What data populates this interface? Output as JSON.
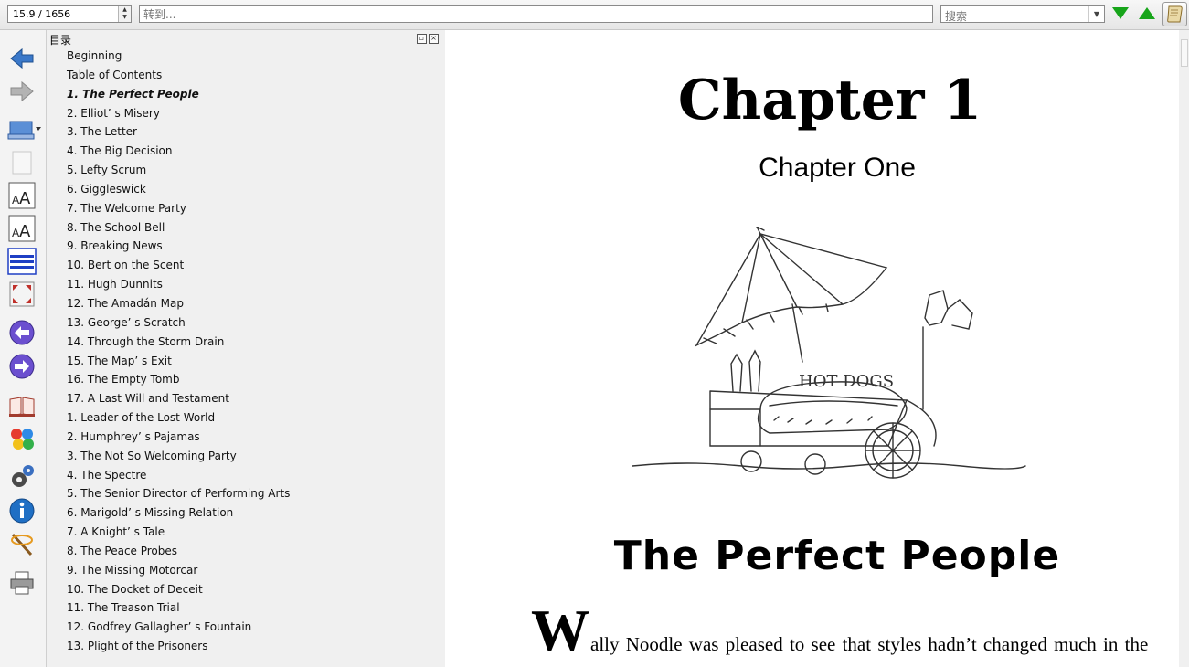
{
  "toolbar": {
    "page_indicator": "15.9 / 1656",
    "goto_placeholder": "转到...",
    "search_placeholder": "搜索",
    "colors": {
      "nav_green": "#17a51a"
    }
  },
  "sidebar_icons": [
    "back-arrow-icon",
    "forward-arrow-icon",
    "library-icon",
    "page-icon",
    "font-increase-icon",
    "font-decrease-icon",
    "toc-list-icon",
    "fullscreen-icon",
    "prev-chapter-icon",
    "next-chapter-icon",
    "book-icon",
    "colors-icon",
    "settings-icon",
    "info-icon",
    "tools-icon",
    "print-icon"
  ],
  "toc": {
    "title": "目录",
    "items": [
      "Beginning",
      "Table of Contents",
      "1. The Perfect People",
      "2. Elliot’ s Misery",
      "3. The Letter",
      "4. The Big Decision",
      "5. Lefty Scrum",
      "6. Giggleswick",
      "7. The Welcome Party",
      "8. The School Bell",
      "9. Breaking News",
      "10. Bert on the Scent",
      "11. Hugh Dunnits",
      "12. The Amadán Map",
      "13. George’ s Scratch",
      "14. Through the Storm Drain",
      "15. The Map’ s Exit",
      "16. The Empty Tomb",
      "17. A Last Will and Testament",
      "1. Leader of the Lost World",
      "2. Humphrey’ s Pajamas",
      "3. The Not So Welcoming Party",
      "4. The Spectre",
      "5. The Senior Director of Performing Arts",
      "6. Marigold’ s Missing Relation",
      "7. A Knight’ s Tale",
      "8. The Peace Probes",
      "9. The Missing Motorcar",
      "10. The Docket of Deceit",
      "11. The Treason Trial",
      "12. Godfrey Gallagher’ s Fountain",
      "13. Plight of the Prisoners"
    ]
  },
  "document": {
    "chapter_heading": "Chapter 1",
    "chapter_subheading": "Chapter One",
    "illustration_sign": "HOT DOGS",
    "chapter_title": "The Perfect People",
    "drop_cap": "W",
    "first_line": "ally Noodle was pleased to see that styles hadn’t changed much in the"
  }
}
